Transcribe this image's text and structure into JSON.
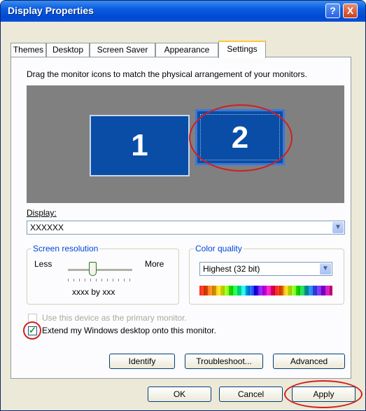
{
  "window": {
    "title": "Display Properties",
    "help_button": "?",
    "close_button": "X"
  },
  "tabs": [
    {
      "label": "Themes"
    },
    {
      "label": "Desktop"
    },
    {
      "label": "Screen Saver"
    },
    {
      "label": "Appearance"
    },
    {
      "label": "Settings",
      "active": true
    }
  ],
  "settings": {
    "instruction": "Drag the monitor icons to match the physical arrangement of your monitors.",
    "monitors": [
      {
        "label": "1"
      },
      {
        "label": "2",
        "selected": true
      }
    ],
    "display_label": "Display:",
    "display_value": "XXXXXX",
    "resolution": {
      "group_title": "Screen resolution",
      "less": "Less",
      "more": "More",
      "value": "xxxx by xxx"
    },
    "color_quality": {
      "group_title": "Color quality",
      "value": "Highest (32 bit)"
    },
    "primary_checkbox": {
      "label": "Use this device as the primary monitor.",
      "checked": false,
      "enabled": false
    },
    "extend_checkbox": {
      "label": "Extend my Windows desktop onto this monitor.",
      "checked": true,
      "enabled": true
    },
    "buttons": {
      "identify": "Identify",
      "troubleshoot": "Troubleshoot...",
      "advanced": "Advanced"
    }
  },
  "footer": {
    "ok": "OK",
    "cancel": "Cancel",
    "apply": "Apply"
  },
  "colors": {
    "titlebar": "#0049d1",
    "monitor_fill": "#0a4da6",
    "desktop_bg": "#808080",
    "annotation_ring": "#d21f1f"
  }
}
